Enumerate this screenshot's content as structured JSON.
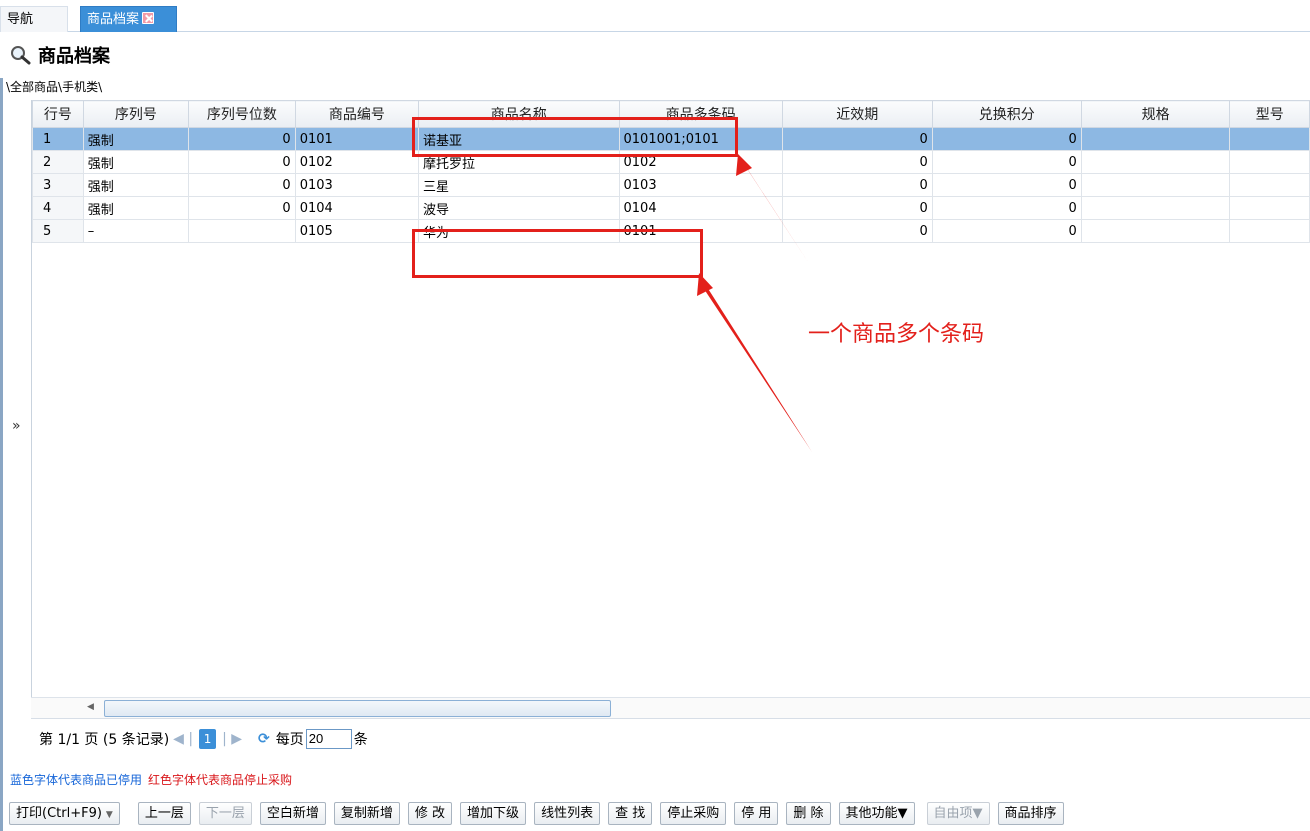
{
  "tabs": {
    "nav": "导航",
    "active": "商品档案"
  },
  "page": {
    "title": "商品档案",
    "breadcrumb": "\\全部商品\\手机类\\",
    "expand_toggle": "»"
  },
  "grid": {
    "columns": [
      "行号",
      "序列号",
      "序列号位数",
      "商品编号",
      "商品名称",
      "商品多条码",
      "近效期",
      "兑换积分",
      "规格",
      "型号"
    ],
    "rows": [
      {
        "row": "1",
        "serial": "强制",
        "serial_digits": "0",
        "code": "0101",
        "name": "诺基亚",
        "barcodes": "0101001;0101",
        "expiry": "0",
        "points": "0",
        "spec": "",
        "model": ""
      },
      {
        "row": "2",
        "serial": "强制",
        "serial_digits": "0",
        "code": "0102",
        "name": "摩托罗拉",
        "barcodes": "0102",
        "expiry": "0",
        "points": "0",
        "spec": "",
        "model": ""
      },
      {
        "row": "3",
        "serial": "强制",
        "serial_digits": "0",
        "code": "0103",
        "name": "三星",
        "barcodes": "0103",
        "expiry": "0",
        "points": "0",
        "spec": "",
        "model": ""
      },
      {
        "row": "4",
        "serial": "强制",
        "serial_digits": "0",
        "code": "0104",
        "name": "波导",
        "barcodes": "0104",
        "expiry": "0",
        "points": "0",
        "spec": "",
        "model": ""
      },
      {
        "row": "5",
        "serial": "–",
        "serial_digits": "",
        "code": "0105",
        "name": "华为",
        "barcodes": "0101",
        "expiry": "0",
        "points": "0",
        "spec": "",
        "model": ""
      }
    ],
    "selected_row": "1"
  },
  "pager": {
    "page_info": "第 1/1 页 (5 条记录)",
    "current_page": "1",
    "per_page_label": "每页",
    "per_page": "20",
    "unit": "条"
  },
  "legend": {
    "blue_text": "蓝色字体代表商品已停用",
    "red_text": "红色字体代表商品停止采购",
    "blue_color": "#1565d8",
    "red_color": "#d9161a"
  },
  "toolbar": {
    "print": "打印(Ctrl+F9)",
    "up_level": "上一层",
    "down_level": "下一层",
    "blank_new": "空白新增",
    "copy_new": "复制新增",
    "edit": "修 改",
    "add_child": "增加下级",
    "linear_list": "线性列表",
    "find": "查 找",
    "stop_purchase": "停止采购",
    "disable": "停 用",
    "delete": "删 除",
    "other": "其他功能▼",
    "custom": "自由项▼",
    "sort": "商品排序"
  },
  "annotation": {
    "text": "一个商品多个条码",
    "color": "#e3201b"
  }
}
